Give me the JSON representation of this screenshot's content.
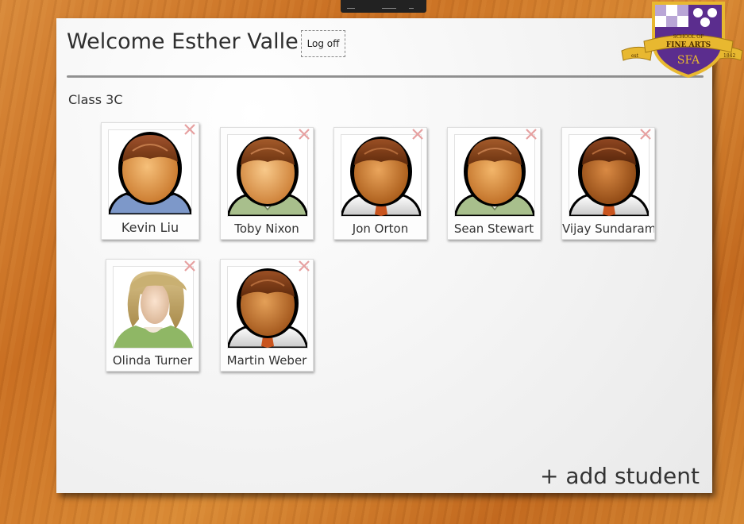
{
  "header": {
    "title": "Welcome Esther Valle!",
    "logoff_label": "Log off"
  },
  "class_name": "Class 3C",
  "students": [
    {
      "name": "Kevin Liu",
      "avatar": "male-blue-sweater-avatar"
    },
    {
      "name": "Toby Nixon",
      "avatar": "male-green-shirt-avatar"
    },
    {
      "name": "Jon Orton",
      "avatar": "male-tie-avatar"
    },
    {
      "name": "Sean Stewart",
      "avatar": "male-green-shirt-avatar"
    },
    {
      "name": "Vijay Sundaram",
      "avatar": "male-tie-avatar"
    },
    {
      "name": "Olinda Turner",
      "avatar": "female-avatar"
    },
    {
      "name": "Martin Weber",
      "avatar": "male-tie-avatar"
    }
  ],
  "add_student_label": "+ add student",
  "crest": {
    "top_text": "SCHOOL OF",
    "main_text": "FINE ARTS",
    "monogram": "SFA",
    "year_left": "est",
    "year_right": "1842"
  },
  "colors": {
    "crest_purple": "#5b2d8e",
    "ribbon_gold": "#e8b830",
    "remove_icon": "#e6a0a0"
  }
}
